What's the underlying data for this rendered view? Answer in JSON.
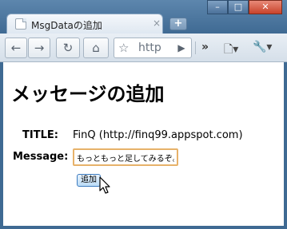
{
  "tab": {
    "title": "MsgDataの追加",
    "close": "×"
  },
  "newtab": {
    "label": "+"
  },
  "window_buttons": {
    "minimize": "–",
    "maximize": "□",
    "close": "✕"
  },
  "toolbar": {
    "back": "←",
    "forward": "→",
    "reload": "↻",
    "home": "⌂",
    "omnibox_text": "http",
    "omnibox_go": "▶",
    "more": "»",
    "page_menu": "🗋▾",
    "wrench_menu": "🔧▾"
  },
  "page": {
    "heading": "メッセージの追加",
    "title_label": "TITLE:",
    "title_value": "FinQ (http://finq99.appspot.com)",
    "message_label": "Message:",
    "message_value": "もっともっと足してみるぞ。",
    "submit_label": "追加"
  }
}
